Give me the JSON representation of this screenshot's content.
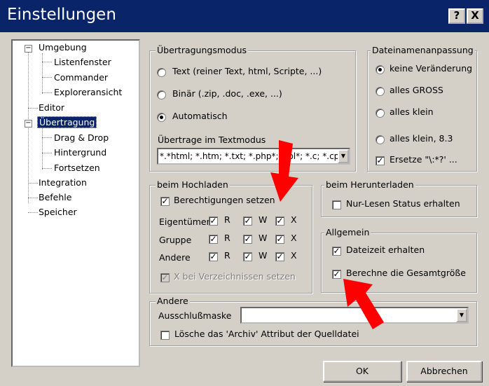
{
  "window": {
    "title": "Einstellungen",
    "help_label": "?",
    "close_label": "X"
  },
  "tree": {
    "items": [
      {
        "label": "Umgebung"
      },
      {
        "label": "Listenfenster"
      },
      {
        "label": "Commander"
      },
      {
        "label": "Exploreransicht"
      },
      {
        "label": "Editor"
      },
      {
        "label": "Übertragung"
      },
      {
        "label": "Drag & Drop"
      },
      {
        "label": "Hintergrund"
      },
      {
        "label": "Fortsetzen"
      },
      {
        "label": "Integration"
      },
      {
        "label": "Befehle"
      },
      {
        "label": "Speicher"
      }
    ]
  },
  "transfer_mode": {
    "title": "Übertragungsmodus",
    "options": [
      {
        "label": "Text (reiner Text, html, Scripte, ...)",
        "selected": false
      },
      {
        "label": "Binär (.zip, .doc, .exe, ...)",
        "selected": false
      },
      {
        "label": "Automatisch",
        "selected": true
      }
    ],
    "text_mode_label": "Übertrage im Textmodus",
    "text_mode_value": "*.*html; *.htm; *.txt; *.php*; *.pl*; *.c; *.cpp"
  },
  "filename": {
    "title": "Dateinamenanpassung",
    "options": [
      {
        "label": "keine Veränderung",
        "selected": true
      },
      {
        "label": "alles GROSS",
        "selected": false
      },
      {
        "label": "alles klein",
        "selected": false
      },
      {
        "label": "alles klein, 8.3",
        "selected": false
      }
    ],
    "replace_label": "Ersetze \"\\:*?' ...",
    "replace_checked": true
  },
  "upload": {
    "title": "beim Hochladen",
    "set_perms_label": "Berechtigungen setzen",
    "rows": [
      {
        "label": "Eigentümer"
      },
      {
        "label": "Gruppe"
      },
      {
        "label": "Andere"
      }
    ],
    "perm_labels": [
      "R",
      "W",
      "X"
    ],
    "dirs_label": "X bei Verzeichnissen setzen"
  },
  "download": {
    "title": "beim Herunterladen",
    "readonly_label": "Nur-Lesen Status erhalten"
  },
  "general": {
    "title": "Allgemein",
    "keep_time_label": "Dateizeit erhalten",
    "calc_size_label": "Berechne die Gesamtgröße"
  },
  "other": {
    "title": "Andere",
    "mask_label": "Ausschlußmaske",
    "mask_value": "",
    "archive_label": "Lösche das 'Archiv' Attribut der Quelldatei"
  },
  "buttons": {
    "ok": "OK",
    "cancel": "Abbrechen"
  },
  "colors": {
    "titlebar": "#0a246a",
    "dialog": "#d4d0c8",
    "selection": "#0a246a",
    "annotation_arrow": "#ff0000"
  }
}
